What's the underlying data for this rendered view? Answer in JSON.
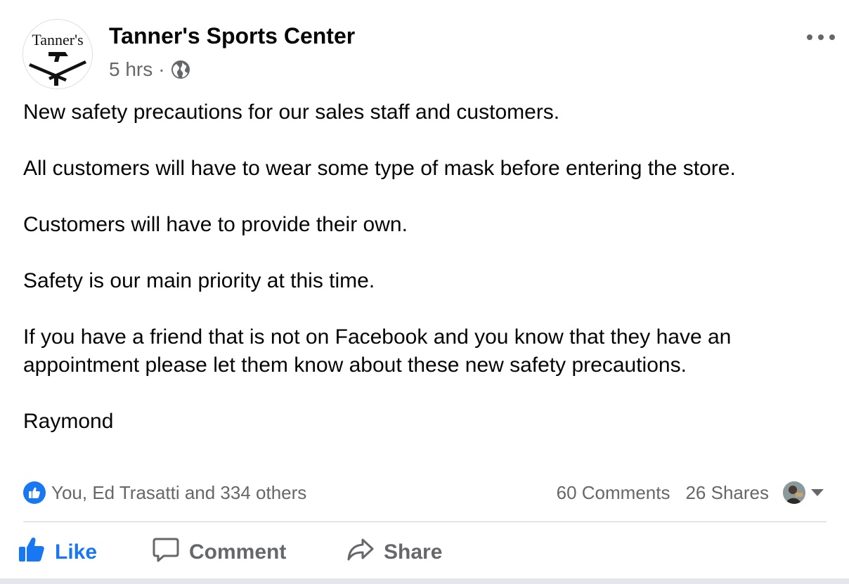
{
  "post": {
    "page_name": "Tanner's Sports Center",
    "avatar_text": "Tanner's",
    "timestamp": "5 hrs",
    "separator": "·",
    "audience_icon": "globe-icon",
    "more_icon": "ellipsis-icon",
    "paragraphs": [
      "New safety precautions for our sales staff and customers.",
      "All customers will have to wear some type of mask before entering the store.",
      "Customers will have to provide their own.",
      "Safety is our main priority at this time.",
      "If you have a friend that is not on Facebook and you know that they have an appointment please let them know about these new safety precautions.",
      "Raymond"
    ]
  },
  "engagement": {
    "reactions_text": "You, Ed Trasatti and 334 others",
    "comments": "60 Comments",
    "shares": "26 Shares"
  },
  "actions": {
    "like": "Like",
    "comment": "Comment",
    "share": "Share"
  },
  "colors": {
    "accent": "#1877f2",
    "secondary_text": "#65676b",
    "primary_text": "#050505",
    "divider": "#ced0d4"
  }
}
